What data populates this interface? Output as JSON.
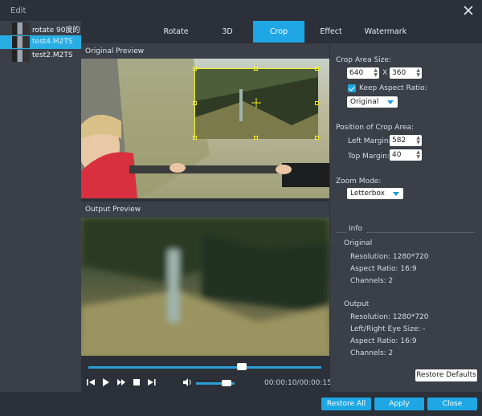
{
  "window": {
    "title": "Edit"
  },
  "files": [
    {
      "name": "rotate 90度的..."
    },
    {
      "name": "test4.M2TS"
    },
    {
      "name": "test2.M2TS"
    }
  ],
  "tabs": [
    "Rotate",
    "3D",
    "Crop",
    "Effect",
    "Watermark"
  ],
  "active_tab": "Crop",
  "preview": {
    "original_label": "Original Preview",
    "output_label": "Output Preview"
  },
  "player": {
    "time": "00:00:10/00:00:15",
    "seek_progress": 0.66,
    "volume": 0.8
  },
  "crop": {
    "area_size_label": "Crop Area Size:",
    "width": "640",
    "height": "360",
    "x_sep": "X",
    "keep_aspect_label": "Keep Aspect Ratio:",
    "keep_aspect_checked": true,
    "aspect_value": "Original",
    "position_label": "Position of Crop Area:",
    "left_margin_label": "Left Margin:",
    "left_margin": "582",
    "top_margin_label": "Top Margin:",
    "top_margin": "40",
    "zoom_label": "Zoom Mode:",
    "zoom_value": "Letterbox"
  },
  "info": {
    "title": "Info",
    "original": {
      "label": "Original",
      "resolution": "Resolution: 1280*720",
      "aspect": "Aspect Ratio: 16:9",
      "channels": "Channels: 2"
    },
    "output": {
      "label": "Output",
      "resolution": "Resolution: 1280*720",
      "eye_size": "Left/Right Eye Size: -",
      "aspect": "Aspect Ratio: 16:9",
      "channels": "Channels: 2"
    }
  },
  "buttons": {
    "restore_defaults": "Restore Defaults",
    "restore_all": "Restore All",
    "apply": "Apply",
    "close": "Close"
  },
  "colors": {
    "accent": "#1ea7e4",
    "crop_frame": "#f7f22a"
  }
}
